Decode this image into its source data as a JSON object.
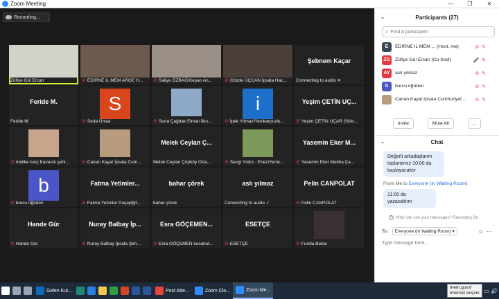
{
  "window": {
    "title": "Zoom Meeting",
    "minimize": "—",
    "maximize": "❐",
    "close": "✕"
  },
  "recording": {
    "label": "Recording..."
  },
  "tiles": [
    {
      "display": "photo",
      "label": "Züfiye Gül Ercan",
      "mic_muted": false,
      "active": true,
      "photo_color": "#cfd3c8"
    },
    {
      "display": "photo",
      "label": "EDIRNE IL MEM ARGE H...",
      "mic_muted": true,
      "active": false,
      "photo_color": "#6d5a4e"
    },
    {
      "display": "photo",
      "label": "Saliye ÖZBAĞ/Keşan An...",
      "mic_muted": true,
      "active": false,
      "photo_color": "#9a8f86"
    },
    {
      "display": "photo",
      "label": "Gözde ÜÇCAN İpsala Hac...",
      "mic_muted": true,
      "active": false,
      "photo_color": "#4a3f39"
    },
    {
      "display": "name",
      "big": "Şebnem Kaçar",
      "label": "Connecting to audio ✕",
      "mic_muted": false,
      "active": false
    },
    {
      "display": "name",
      "big": "Feride M.",
      "label": "Feride M.",
      "mic_muted": false,
      "active": false
    },
    {
      "display": "letter",
      "letter": "S",
      "letter_color": "#d9461e",
      "label": "Seda Ünsal",
      "mic_muted": true,
      "active": false
    },
    {
      "display": "small_photo",
      "label": "Suna Çağdak Elmalı İlko...",
      "mic_muted": true,
      "active": false,
      "photo_color": "#8fa9c9"
    },
    {
      "display": "letter",
      "letter": "i",
      "letter_color": "#1d6fc9",
      "label": "İpek Yılmaz/Yenikarpuzlu...",
      "mic_muted": true,
      "active": false
    },
    {
      "display": "name",
      "big": "Yeşim ÇETİN UÇ...",
      "label": "Yeşim ÇETİN UÇAR (Sülo...",
      "mic_muted": true,
      "active": false
    },
    {
      "display": "small_photo",
      "label": "melike tunç Kavacık şehi...",
      "mic_muted": true,
      "active": false,
      "photo_color": "#c7a48c"
    },
    {
      "display": "small_photo",
      "label": "Canan Kaya/ İpsala Cum...",
      "mic_muted": true,
      "active": false,
      "photo_color": "#b89a7d"
    },
    {
      "display": "name",
      "big": "Melek Ceylan Ç...",
      "label": "Melek Ceylan Çöpköy Orta...",
      "mic_muted": false,
      "active": false
    },
    {
      "display": "small_photo",
      "label": "Sevgi Yıldız - Enez/Yenic...",
      "mic_muted": true,
      "active": false,
      "photo_color": "#7e9a5a"
    },
    {
      "display": "name",
      "big": "Yasemin Eker M...",
      "label": "Yasemin Eker Meliha Ça...",
      "mic_muted": true,
      "active": false
    },
    {
      "display": "letter",
      "letter": "b",
      "letter_color": "#4a56c7",
      "label": "burcu üğüden",
      "mic_muted": true,
      "active": false
    },
    {
      "display": "name",
      "big": "Fatma Yetimler...",
      "label": "Fatma Yetimler Paşayiğit...",
      "mic_muted": true,
      "active": false
    },
    {
      "display": "name",
      "big": "bahar çörek",
      "label": "bahar çörek",
      "mic_muted": false,
      "active": false
    },
    {
      "display": "name",
      "big": "aslı yılmaz",
      "label": "Connecting to audio ✓",
      "mic_muted": false,
      "active": false
    },
    {
      "display": "name",
      "big": "Pelin CANPOLAT",
      "label": "Pelin CANPOLAT",
      "mic_muted": true,
      "active": false
    },
    {
      "display": "name",
      "big": "Hande Gür",
      "label": "Hande Gür",
      "mic_muted": true,
      "active": false
    },
    {
      "display": "name",
      "big": "Nuray Balbay İp...",
      "label": "Nuray Balbay İpsala Şeh...",
      "mic_muted": true,
      "active": false
    },
    {
      "display": "name",
      "big": "Esra GÖÇEMEN...",
      "label": "Esra GÖÇEMEN kocahıd...",
      "mic_muted": true,
      "active": false
    },
    {
      "display": "name",
      "big": "ESETÇE",
      "label": "ESETÇE",
      "mic_muted": true,
      "active": false
    },
    {
      "display": "small_photo",
      "label": "Funda Bekar",
      "mic_muted": true,
      "active": false,
      "photo_color": "#3a2f35"
    }
  ],
  "participants": {
    "title": "Participants (27)",
    "search_placeholder": "Find a participant",
    "list": [
      {
        "initials": "E",
        "color": "#3b4a5a",
        "name": "EDIRNE IL MEM ... (Host, me)",
        "icons": "⊘ ✎"
      },
      {
        "initials": "ZG",
        "color": "#e0393e",
        "name": "Züfiye Gül Ercan (Co-host)",
        "icons": "🎤 ✎"
      },
      {
        "initials": "AY",
        "color": "#e0393e",
        "name": "aslı yılmaz",
        "icons": "⊘ ✎"
      },
      {
        "initials": "b",
        "color": "#4a56c7",
        "name": "burcu üğüden",
        "icons": "⊘ ✎"
      },
      {
        "initials": "",
        "color": "#b89a7d",
        "name": "Canan Kaya/ İpsala Cumhuriyet ...",
        "icons": "⊘ ✎"
      }
    ],
    "invite": "Invite",
    "mute_all": "Mute All",
    "more": "..."
  },
  "chat": {
    "title": "Chat",
    "messages": [
      "Değerli arkadaşlarım toplantımız 10:00 da başlayacaktır"
    ],
    "from_line_prefix": "From Me to ",
    "from_line_to": "Everyone (in Waiting Room)",
    "from_line_suffix": ":",
    "message2": "11:00 da yazacaktım",
    "who_see": "Who can see your messages? Recording On",
    "to_label": "To:",
    "to_value": "Everyone (in Waiting Room) ▾",
    "input_placeholder": "Type message here..."
  },
  "taskbar": {
    "items": [
      {
        "label": "",
        "color": "#ffffff"
      },
      {
        "label": "",
        "color": "#9aa5b1"
      },
      {
        "label": "",
        "color": "#9aa5b1"
      },
      {
        "label": "Gelen Kut...",
        "color": "#0f6cbd"
      },
      {
        "label": "",
        "color": "#1f8a70"
      },
      {
        "label": "",
        "color": "#2a7de1"
      },
      {
        "label": "",
        "color": "#f2c94c"
      },
      {
        "label": "",
        "color": "#2f9e44"
      },
      {
        "label": "",
        "color": "#d24726"
      },
      {
        "label": "",
        "color": "#2b579a"
      },
      {
        "label": "",
        "color": "#2b579a"
      },
      {
        "label": "Post Atte...",
        "color": "#e8453c"
      },
      {
        "label": "Zoom Clo...",
        "color": "#2d8cff"
      },
      {
        "label": "Zoom Me...",
        "color": "#2d8cff"
      }
    ],
    "tooltip_line1": "mem.gov.tr",
    "tooltip_line2": "Internet erişimi",
    "tray": "˄ ▭ 🔊"
  }
}
